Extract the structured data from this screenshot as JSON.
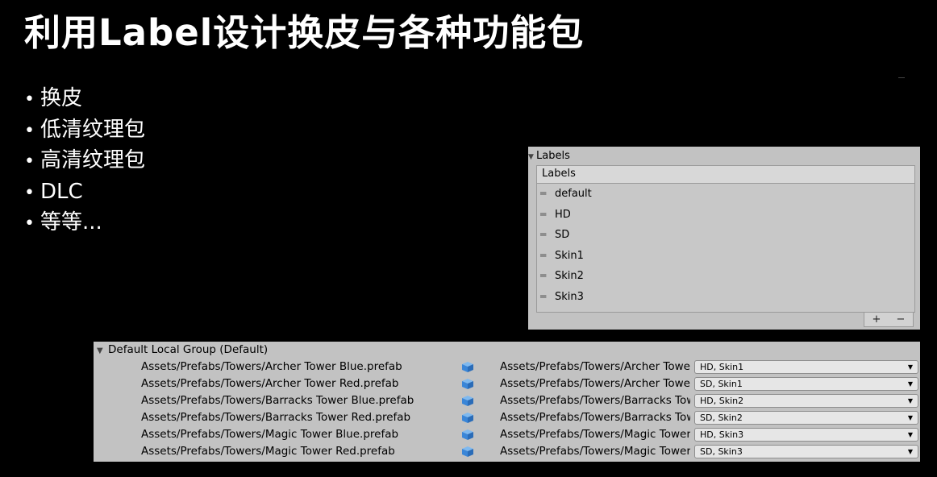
{
  "slide": {
    "title": "利用Label设计换皮与各种功能包",
    "bullets": [
      "换皮",
      "低清纹理包",
      "高清纹理包",
      "DLC",
      "等等..."
    ]
  },
  "labels_panel": {
    "header": "Labels",
    "list_title": "Labels",
    "items": [
      "default",
      "HD",
      "SD",
      "Skin1",
      "Skin2",
      "Skin3"
    ],
    "add_label": "+",
    "remove_label": "−"
  },
  "group_panel": {
    "title": "Default Local Group (Default)",
    "rows": [
      {
        "name": "Assets/Prefabs/Towers/Archer Tower Blue.prefab",
        "path": "Assets/Prefabs/Towers/Archer Tower Blue.prefab",
        "labels": "HD, Skin1"
      },
      {
        "name": "Assets/Prefabs/Towers/Archer Tower Red.prefab",
        "path": "Assets/Prefabs/Towers/Archer Tower Red.prefab",
        "labels": "SD, Skin1"
      },
      {
        "name": "Assets/Prefabs/Towers/Barracks Tower Blue.prefab",
        "path": "Assets/Prefabs/Towers/Barracks Tower Blue.prefab",
        "labels": "HD, Skin2"
      },
      {
        "name": "Assets/Prefabs/Towers/Barracks Tower Red.prefab",
        "path": "Assets/Prefabs/Towers/Barracks Tower Red.prefab",
        "labels": "SD, Skin2"
      },
      {
        "name": "Assets/Prefabs/Towers/Magic Tower Blue.prefab",
        "path": "Assets/Prefabs/Towers/Magic Tower Blue.prefab",
        "labels": "HD, Skin3"
      },
      {
        "name": "Assets/Prefabs/Towers/Magic Tower Red.prefab",
        "path": "Assets/Prefabs/Towers/Magic Tower Red.prefab",
        "labels": "SD, Skin3"
      }
    ]
  },
  "icons": {
    "prefab": "prefab-cube-icon",
    "dropdown": "dropdown-arrow-icon",
    "foldout": "foldout-triangle-icon",
    "drag": "drag-handle-icon"
  },
  "colors": {
    "background": "#000000",
    "panel": "#c2c2c2",
    "prefab_icon": "#3a86d8"
  }
}
